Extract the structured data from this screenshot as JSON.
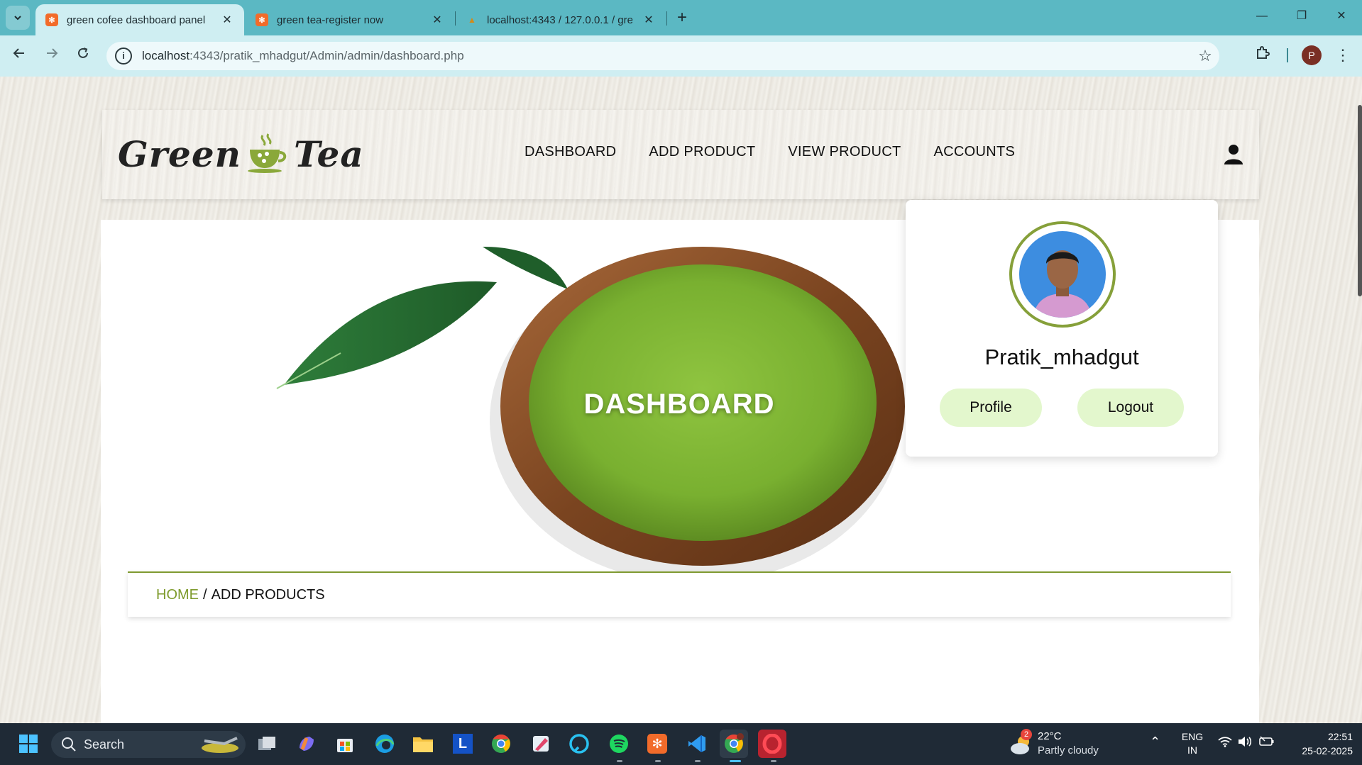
{
  "browser": {
    "tabs": [
      {
        "title": "green cofee dashboard panel",
        "active": true
      },
      {
        "title": "green tea-register now",
        "active": false
      },
      {
        "title": "localhost:4343 / 127.0.0.1 / gre",
        "active": false
      }
    ],
    "url_host": "localhost",
    "url_path": ":4343/pratik_mhadgut/Admin/admin/dashboard.php",
    "profile_initial": "P"
  },
  "site": {
    "logo": {
      "word1": "Green",
      "word2": "Tea"
    },
    "nav": [
      {
        "label": "DASHBOARD"
      },
      {
        "label": "ADD PRODUCT"
      },
      {
        "label": "VIEW PRODUCT"
      },
      {
        "label": "ACCOUNTS"
      }
    ],
    "hero_title": "DASHBOARD",
    "breadcrumb": {
      "home": "HOME",
      "separator": "/",
      "current": "ADD PRODUCTS"
    },
    "profile": {
      "username": "Pratik_mhadgut",
      "profile_button": "Profile",
      "logout_button": "Logout"
    },
    "colors": {
      "accent_green": "#7e9b2c",
      "button_bg": "#e3f7cd"
    }
  },
  "taskbar": {
    "search_label": "Search",
    "weather": {
      "temp": "22°C",
      "condition": "Partly cloudy",
      "badge": "2"
    },
    "lang": {
      "line1": "ENG",
      "line2": "IN"
    },
    "clock": {
      "time": "22:51",
      "date": "25-02-2025"
    }
  }
}
